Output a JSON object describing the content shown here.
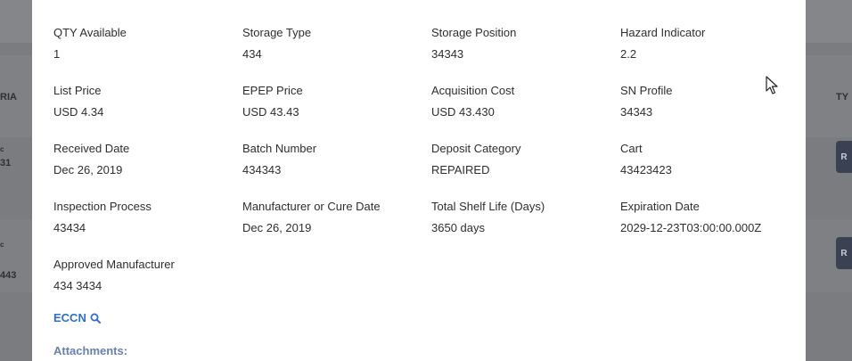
{
  "background": {
    "col_header_left": "RIA",
    "col_header_right": "TY",
    "row1_frag_top": "c",
    "row1_frag_bottom": "31",
    "row2_frag_top": "c",
    "row2_frag_mid": "",
    "row2_frag_bottom": "443",
    "row_button_label": "R"
  },
  "modal": {
    "fields": [
      {
        "label": "QTY Available",
        "value": "1"
      },
      {
        "label": "Storage Type",
        "value": "434"
      },
      {
        "label": "Storage Position",
        "value": "34343"
      },
      {
        "label": "Hazard Indicator",
        "value": "2.2"
      },
      {
        "label": "List Price",
        "value": "USD 4.34"
      },
      {
        "label": "EPEP Price",
        "value": "USD 43.43"
      },
      {
        "label": "Acquisition Cost",
        "value": "USD 43.430"
      },
      {
        "label": "SN Profile",
        "value": "34343"
      },
      {
        "label": "Received Date",
        "value": "Dec 26, 2019"
      },
      {
        "label": "Batch Number",
        "value": "434343"
      },
      {
        "label": "Deposit Category",
        "value": "REPAIRED"
      },
      {
        "label": "Cart",
        "value": "43423423"
      },
      {
        "label": "Inspection Process",
        "value": "43434"
      },
      {
        "label": "Manufacturer or Cure Date",
        "value": "Dec 26, 2019"
      },
      {
        "label": "Total Shelf Life (Days)",
        "value": "3650 days"
      },
      {
        "label": "Expiration Date",
        "value": "2029-12-23T03:00:00.000Z"
      },
      {
        "label": "Approved Manufacturer",
        "value": "434 3434"
      }
    ],
    "eccn_link": "ECCN",
    "attachments_label": "Attachments:",
    "link_color": "#2d6ed0"
  }
}
